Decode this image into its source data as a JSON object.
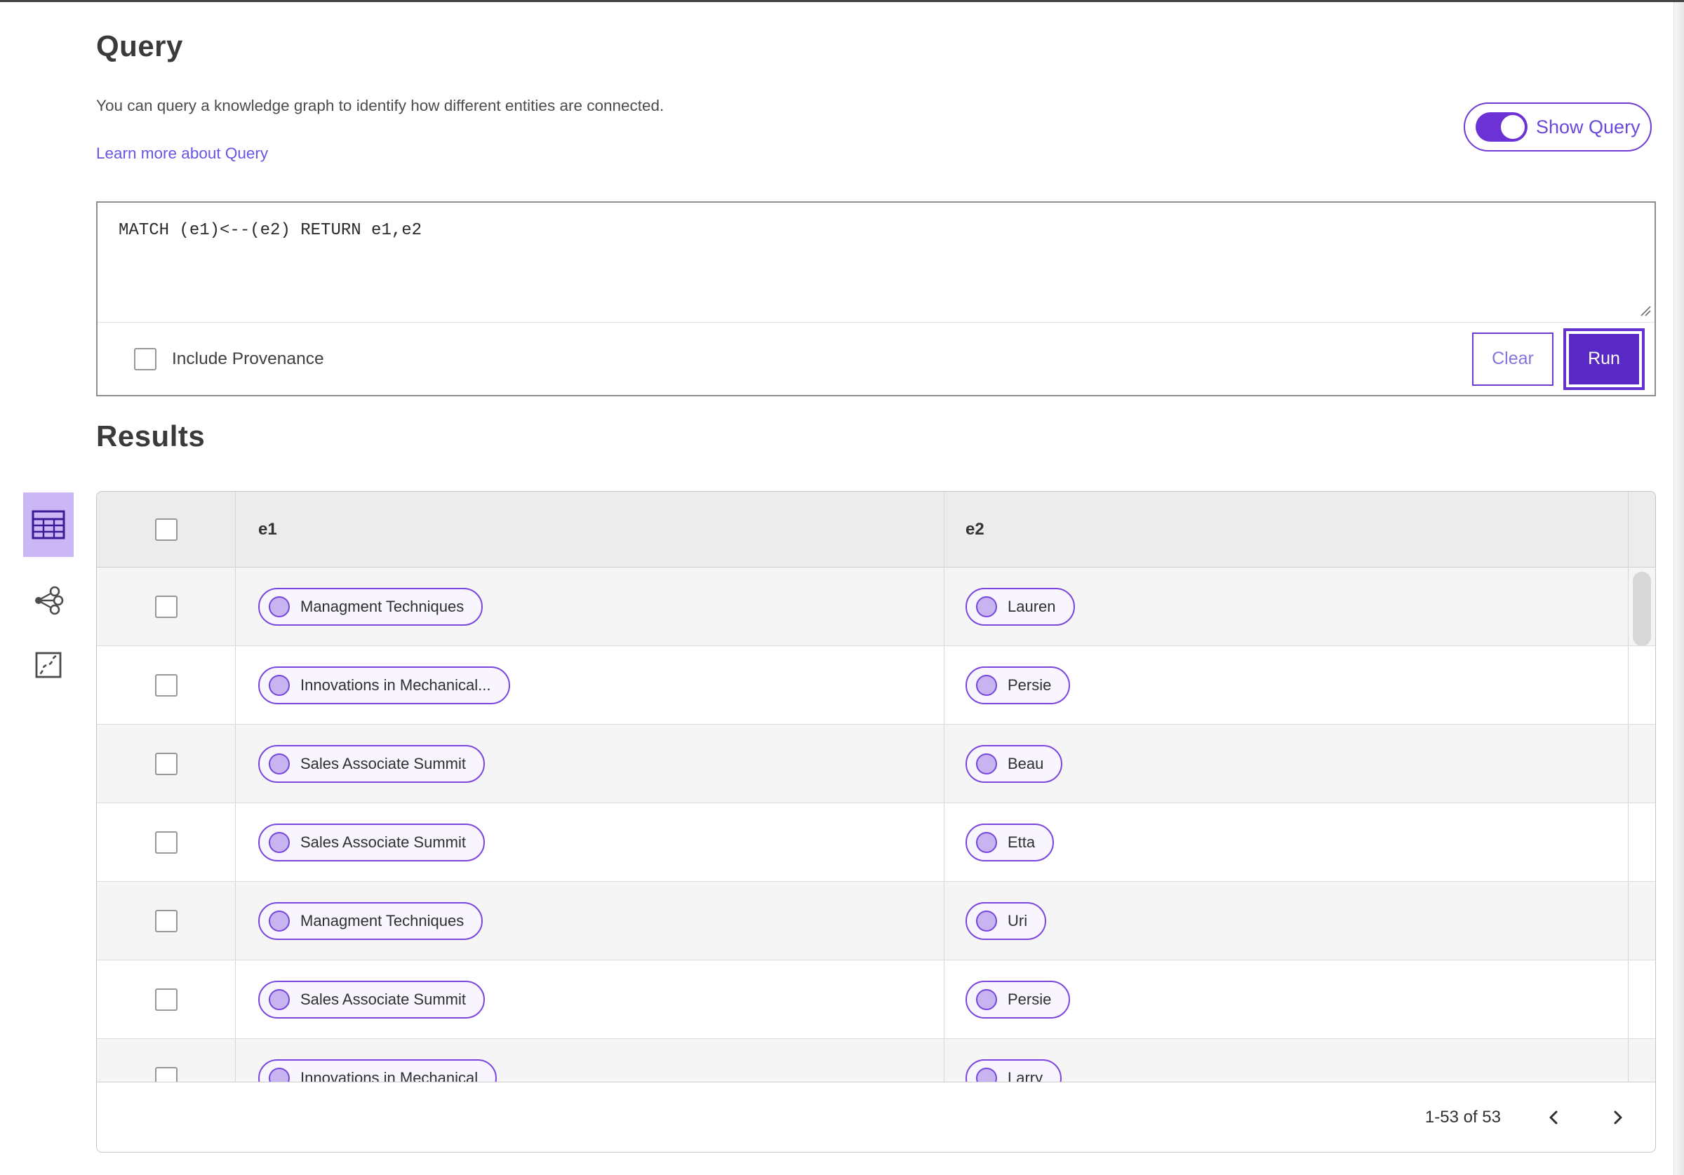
{
  "page": {
    "query": {
      "title": "Query",
      "description": "You can query a knowledge graph to identify how different entities are connected.",
      "learn_more_link": "Learn more about Query",
      "show_query_toggle": {
        "label": "Show Query",
        "state": "on"
      },
      "editor_text": "MATCH (e1)<--(e2) RETURN e1,e2",
      "include_provenance": {
        "label": "Include Provenance",
        "checked": false
      },
      "buttons": {
        "clear": "Clear",
        "run": "Run"
      }
    },
    "results": {
      "title": "Results",
      "view_switcher": [
        {
          "name": "table-view",
          "selected": true
        },
        {
          "name": "graph-view",
          "selected": false
        },
        {
          "name": "map-view",
          "selected": false
        }
      ],
      "table": {
        "columns": [
          "e1",
          "e2"
        ],
        "rows": [
          {
            "e1": "Managment Techniques",
            "e2": "Lauren"
          },
          {
            "e1": "Innovations in Mechanical...",
            "e2": "Persie"
          },
          {
            "e1": "Sales Associate Summit",
            "e2": "Beau"
          },
          {
            "e1": "Sales Associate Summit",
            "e2": "Etta"
          },
          {
            "e1": "Managment Techniques",
            "e2": "Uri"
          },
          {
            "e1": "Sales Associate Summit",
            "e2": "Persie"
          },
          {
            "e1": "Innovations in Mechanical",
            "e2": "Larry"
          }
        ]
      },
      "pagination": {
        "range_label": "1-53 of 53"
      }
    },
    "colors": {
      "accent": "#5a28c4",
      "toggle": "#6c32d6",
      "pill_border": "#7a46e0",
      "selected_view_bg": "#cbb6f6",
      "link": "#6756e4"
    }
  }
}
